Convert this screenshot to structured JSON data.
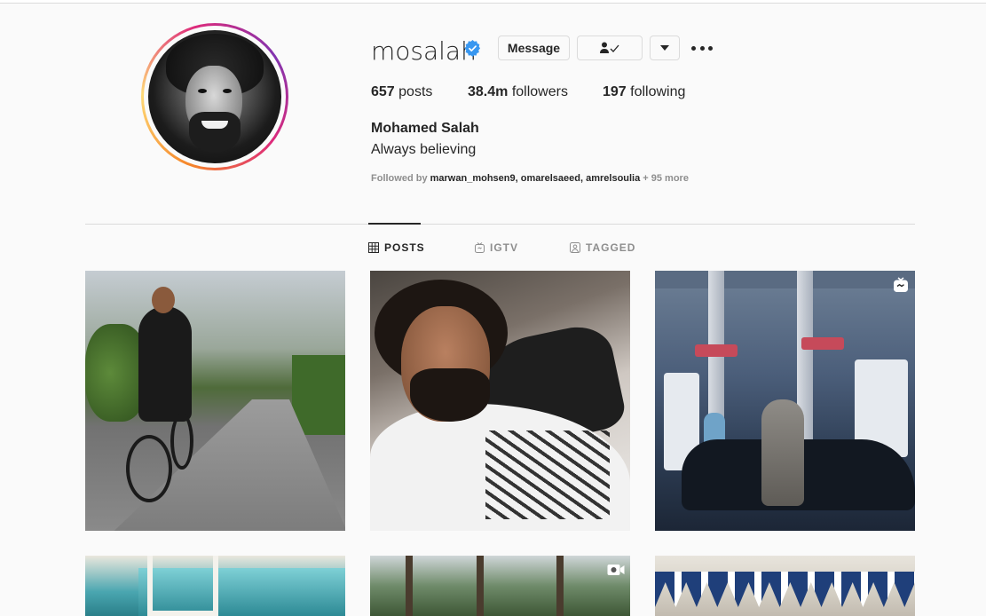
{
  "profile": {
    "username": "mosalah",
    "verified": true,
    "full_name": "Mohamed Salah",
    "bio": "Always believing",
    "followed_by_prefix": "Followed by ",
    "followed_by_names": "marwan_mohsen9, omarelsaeed, amrelsoulia",
    "followed_by_more": " + 95 more"
  },
  "actions": {
    "message_label": "Message",
    "following_icon": "person-check-icon",
    "dropdown_icon": "caret-down-icon",
    "more_icon": "more-options-icon"
  },
  "stats": {
    "posts_count": "657",
    "posts_label": " posts",
    "followers_count": "38.4m",
    "followers_label": " followers",
    "following_count": "197",
    "following_label": " following"
  },
  "tabs": [
    {
      "label": "POSTS",
      "icon": "grid-icon",
      "active": true
    },
    {
      "label": "IGTV",
      "icon": "igtv-icon",
      "active": false
    },
    {
      "label": "TAGGED",
      "icon": "tagged-icon",
      "active": false
    }
  ],
  "posts": [
    {
      "description_icon": "photo",
      "badge": null
    },
    {
      "description_icon": "photo",
      "badge": null
    },
    {
      "description_icon": "photo",
      "badge": "igtv-icon"
    },
    {
      "description_icon": "photo",
      "badge": null
    },
    {
      "description_icon": "photo",
      "badge": "video-icon"
    },
    {
      "description_icon": "photo",
      "badge": null
    }
  ],
  "colors": {
    "verified_blue": "#3897f0",
    "text_primary": "#262626",
    "text_secondary": "#8e8e8e",
    "border": "#dbdbdb",
    "background": "#fafafa"
  }
}
